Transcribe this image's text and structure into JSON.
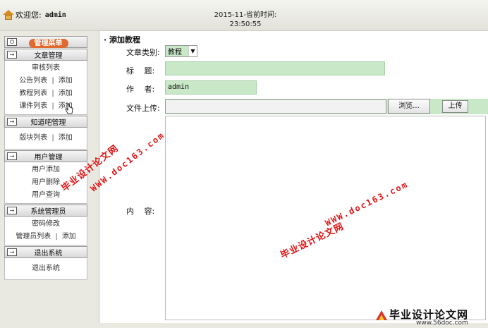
{
  "header": {
    "welcome_label": "欢迎您:",
    "username": "admin",
    "time_line1": "2015-11-省前时间:",
    "time_line2": "23:50:55"
  },
  "sidebar": {
    "menu_title": "管理菜单",
    "groups": [
      {
        "title": "文章管理",
        "rows": [
          {
            "a": "审核列表"
          },
          {
            "a": "公告列表",
            "b": "添加"
          },
          {
            "a": "教程列表",
            "b": "添加"
          },
          {
            "a": "课件列表",
            "b": "添加"
          }
        ]
      },
      {
        "title": "知道吧管理",
        "rows": [
          {
            "a": "版块列表",
            "b": "添加"
          }
        ]
      },
      {
        "title": "用户管理",
        "rows": [
          {
            "a": "用户添加"
          },
          {
            "a": "用户删除"
          },
          {
            "a": "用户查询"
          }
        ]
      },
      {
        "title": "系统管理员",
        "rows": [
          {
            "a": "密码修改"
          },
          {
            "a": "管理员列表",
            "b": "添加"
          }
        ]
      },
      {
        "title": "退出系统",
        "rows": [
          {
            "a": "退出系统"
          }
        ]
      }
    ],
    "separator": "|"
  },
  "form": {
    "panel_title": "· 添加教程",
    "category_label": "文章类别:",
    "category_value": "教程",
    "title_label": "标　 题:",
    "title_value": "",
    "author_label": "作　 者:",
    "author_value": "admin",
    "upload_label": "文件上传:",
    "browse_label": "浏览...",
    "upload_button": "上传",
    "content_label": "内　 容:"
  },
  "watermarks": {
    "cn": "毕业设计论文网",
    "url": "WWW.doc163.com"
  },
  "bottom_logo": {
    "cn": "毕业设计论文网",
    "url": "www.56doc.com"
  }
}
